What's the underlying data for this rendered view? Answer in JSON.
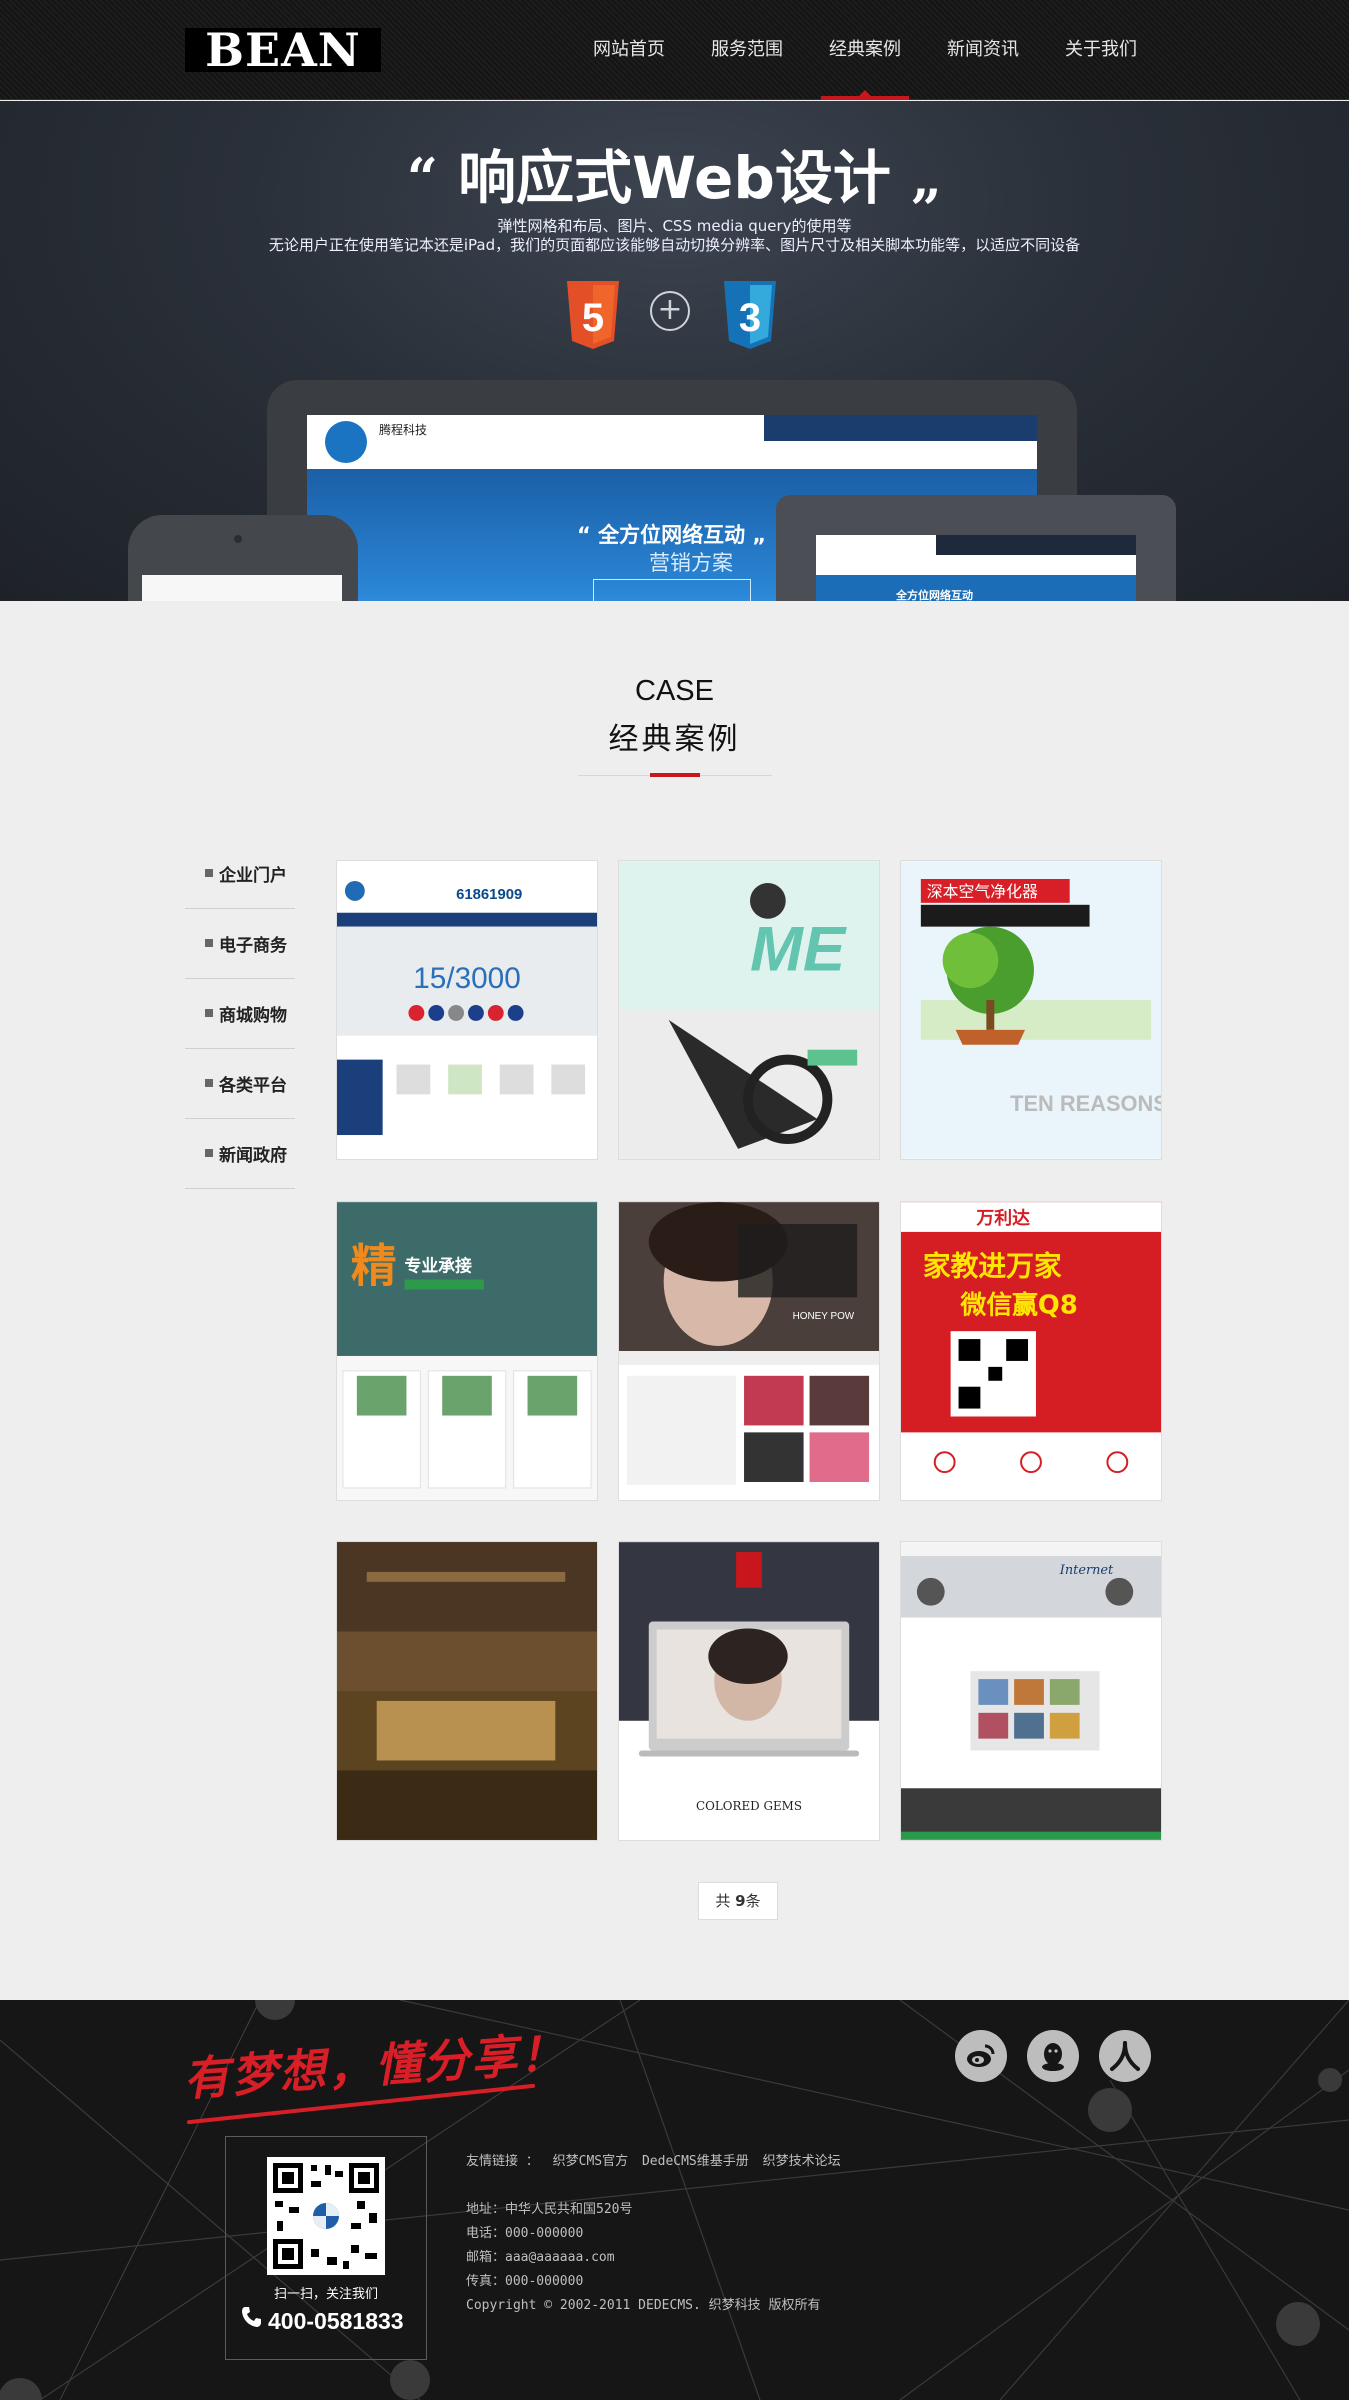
{
  "header": {
    "logo": "BEAN",
    "nav": [
      {
        "label": "网站首页"
      },
      {
        "label": "服务范围"
      },
      {
        "label": "经典案例"
      },
      {
        "label": "新闻资讯"
      },
      {
        "label": "关于我们"
      }
    ],
    "active_nav": "经典案例"
  },
  "banner": {
    "title": "响应式Web设计",
    "quote_open": "“",
    "quote_close": "„",
    "subtitle_line1": "弹性网格和布局、图片、CSS media query的使用等",
    "subtitle_line2": "无论用户正在使用笔记本还是iPad，我们的页面都应该能够自动切换分辨率、图片尺寸及相关脚本功能等，以适应不同设备",
    "tablet_slogan": "“ 全方位网络互动 „",
    "tablet_slogan2": "营销方案",
    "tablet_brand": "腾程科技",
    "laptop_slogan": "全方位网络互动"
  },
  "case": {
    "title_en": "CASE",
    "title_cn": "经典案例",
    "categories": [
      {
        "label": "企业门户"
      },
      {
        "label": "电子商务"
      },
      {
        "label": "商城购物"
      },
      {
        "label": "各类平台"
      },
      {
        "label": "新闻政府"
      }
    ],
    "items": [
      {
        "thumb": "corporate-portal-site",
        "text": "15/3000"
      },
      {
        "thumb": "extreme-sports-site",
        "text": "ME"
      },
      {
        "thumb": "air-purifier-site",
        "text": "深本空气净化器"
      },
      {
        "thumb": "auto-parts-site",
        "text": "专业承接"
      },
      {
        "thumb": "cosmetics-site",
        "text": "HONEY POW"
      },
      {
        "thumb": "education-wechat-site",
        "text": "万利达"
      },
      {
        "thumb": "hotel-site",
        "text": ""
      },
      {
        "thumb": "jewelry-site",
        "text": "COLORED GEMS"
      },
      {
        "thumb": "internet-business-site",
        "text": "Internet"
      }
    ],
    "pagination": {
      "prefix": "共 ",
      "count": "9",
      "suffix": "条"
    }
  },
  "footer": {
    "slogan": "有梦想，懂分享！",
    "social": [
      {
        "icon": "weibo-icon"
      },
      {
        "icon": "qq-icon"
      },
      {
        "icon": "renren-icon"
      }
    ],
    "qr_caption": "扫一扫，关注我们",
    "phone": "400-0581833",
    "links_label": "友情链接 ：",
    "links": [
      "织梦CMS官方",
      "DedeCMS维基手册",
      "织梦技术论坛"
    ],
    "address": "地址：中华人民共和国520号",
    "tel": "电话：000-000000",
    "email": "邮箱：aaa@aaaaaa.com",
    "fax": "传真：000-000000",
    "copyright": "Copyright © 2002-2011 DEDECMS. 织梦科技 版权所有"
  },
  "colors": {
    "accent": "#c9161c",
    "header_bg": "#181818",
    "footer_bg": "#161616",
    "page_bg": "#eeeeee"
  }
}
